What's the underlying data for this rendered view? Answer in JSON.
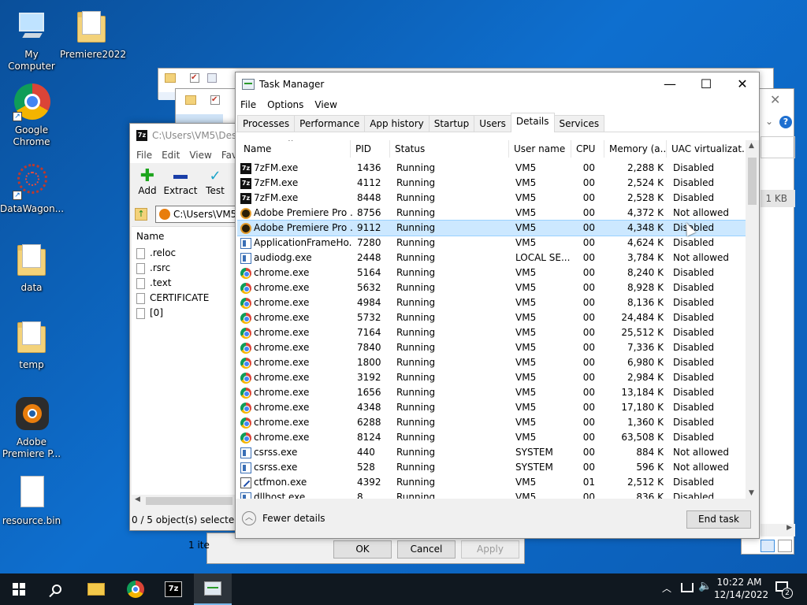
{
  "desktop": {
    "icons": [
      {
        "label": "My Computer",
        "icon": "monitor-icon"
      },
      {
        "label": "Premiere2022",
        "icon": "folder-icon"
      },
      {
        "label": "Google Chrome",
        "icon": "chrome-icon"
      },
      {
        "label": "DataWagon...",
        "icon": "datawagon-icon"
      },
      {
        "label": "data",
        "icon": "folder-icon"
      },
      {
        "label": "temp",
        "icon": "folder-icon"
      },
      {
        "label": "Adobe Premiere P...",
        "icon": "blender-icon"
      },
      {
        "label": "resource.bin",
        "icon": "file-icon"
      }
    ]
  },
  "zip_window": {
    "path": "C:\\Users\\VM5\\Desk",
    "menu": [
      "File",
      "Edit",
      "View",
      "Favo"
    ],
    "toolbar": {
      "add": "Add",
      "extract": "Extract",
      "test": "Test"
    },
    "address": "C:\\Users\\VM5\\",
    "list_header": "Name",
    "items": [
      ".reloc",
      ".rsrc",
      ".text",
      "CERTIFICATE",
      "[0]"
    ],
    "status": "0 / 5 object(s) selected"
  },
  "props_window": {
    "status_left": "1 ite",
    "ok": "OK",
    "cancel": "Cancel",
    "apply": "Apply"
  },
  "right_window": {
    "size_text": "1 KB"
  },
  "task_manager": {
    "title": "Task Manager",
    "menu": [
      "File",
      "Options",
      "View"
    ],
    "tabs": [
      "Processes",
      "Performance",
      "App history",
      "Startup",
      "Users",
      "Details",
      "Services"
    ],
    "active_tab": "Details",
    "columns": [
      "Name",
      "PID",
      "Status",
      "User name",
      "CPU",
      "Memory (a...",
      "UAC virtualizat..."
    ],
    "rows": [
      {
        "name": "7zFM.exe",
        "pid": "1436",
        "status": "Running",
        "user": "VM5",
        "cpu": "00",
        "mem": "2,288 K",
        "uac": "Disabled",
        "icon": "7z"
      },
      {
        "name": "7zFM.exe",
        "pid": "4112",
        "status": "Running",
        "user": "VM5",
        "cpu": "00",
        "mem": "2,524 K",
        "uac": "Disabled",
        "icon": "7z"
      },
      {
        "name": "7zFM.exe",
        "pid": "8448",
        "status": "Running",
        "user": "VM5",
        "cpu": "00",
        "mem": "2,528 K",
        "uac": "Disabled",
        "icon": "7z"
      },
      {
        "name": "Adobe Premiere Pro ...",
        "pid": "8756",
        "status": "Running",
        "user": "VM5",
        "cpu": "00",
        "mem": "4,372 K",
        "uac": "Not allowed",
        "icon": "pr"
      },
      {
        "name": "Adobe Premiere Pro ...",
        "pid": "9112",
        "status": "Running",
        "user": "VM5",
        "cpu": "00",
        "mem": "4,348 K",
        "uac": "Disabled",
        "icon": "pr"
      },
      {
        "name": "ApplicationFrameHo...",
        "pid": "7280",
        "status": "Running",
        "user": "VM5",
        "cpu": "00",
        "mem": "4,624 K",
        "uac": "Disabled",
        "icon": "app"
      },
      {
        "name": "audiodg.exe",
        "pid": "2448",
        "status": "Running",
        "user": "LOCAL SE...",
        "cpu": "00",
        "mem": "3,784 K",
        "uac": "Not allowed",
        "icon": "app"
      },
      {
        "name": "chrome.exe",
        "pid": "5164",
        "status": "Running",
        "user": "VM5",
        "cpu": "00",
        "mem": "8,240 K",
        "uac": "Disabled",
        "icon": "chrome"
      },
      {
        "name": "chrome.exe",
        "pid": "5632",
        "status": "Running",
        "user": "VM5",
        "cpu": "00",
        "mem": "8,928 K",
        "uac": "Disabled",
        "icon": "chrome"
      },
      {
        "name": "chrome.exe",
        "pid": "4984",
        "status": "Running",
        "user": "VM5",
        "cpu": "00",
        "mem": "8,136 K",
        "uac": "Disabled",
        "icon": "chrome"
      },
      {
        "name": "chrome.exe",
        "pid": "5732",
        "status": "Running",
        "user": "VM5",
        "cpu": "00",
        "mem": "24,484 K",
        "uac": "Disabled",
        "icon": "chrome"
      },
      {
        "name": "chrome.exe",
        "pid": "7164",
        "status": "Running",
        "user": "VM5",
        "cpu": "00",
        "mem": "25,512 K",
        "uac": "Disabled",
        "icon": "chrome"
      },
      {
        "name": "chrome.exe",
        "pid": "7840",
        "status": "Running",
        "user": "VM5",
        "cpu": "00",
        "mem": "7,336 K",
        "uac": "Disabled",
        "icon": "chrome"
      },
      {
        "name": "chrome.exe",
        "pid": "1800",
        "status": "Running",
        "user": "VM5",
        "cpu": "00",
        "mem": "6,980 K",
        "uac": "Disabled",
        "icon": "chrome"
      },
      {
        "name": "chrome.exe",
        "pid": "3192",
        "status": "Running",
        "user": "VM5",
        "cpu": "00",
        "mem": "2,984 K",
        "uac": "Disabled",
        "icon": "chrome"
      },
      {
        "name": "chrome.exe",
        "pid": "1656",
        "status": "Running",
        "user": "VM5",
        "cpu": "00",
        "mem": "13,184 K",
        "uac": "Disabled",
        "icon": "chrome"
      },
      {
        "name": "chrome.exe",
        "pid": "4348",
        "status": "Running",
        "user": "VM5",
        "cpu": "00",
        "mem": "17,180 K",
        "uac": "Disabled",
        "icon": "chrome"
      },
      {
        "name": "chrome.exe",
        "pid": "6288",
        "status": "Running",
        "user": "VM5",
        "cpu": "00",
        "mem": "1,360 K",
        "uac": "Disabled",
        "icon": "chrome"
      },
      {
        "name": "chrome.exe",
        "pid": "8124",
        "status": "Running",
        "user": "VM5",
        "cpu": "00",
        "mem": "63,508 K",
        "uac": "Disabled",
        "icon": "chrome"
      },
      {
        "name": "csrss.exe",
        "pid": "440",
        "status": "Running",
        "user": "SYSTEM",
        "cpu": "00",
        "mem": "884 K",
        "uac": "Not allowed",
        "icon": "app"
      },
      {
        "name": "csrss.exe",
        "pid": "528",
        "status": "Running",
        "user": "SYSTEM",
        "cpu": "00",
        "mem": "596 K",
        "uac": "Not allowed",
        "icon": "app"
      },
      {
        "name": "ctfmon.exe",
        "pid": "4392",
        "status": "Running",
        "user": "VM5",
        "cpu": "01",
        "mem": "2,512 K",
        "uac": "Disabled",
        "icon": "ctf"
      },
      {
        "name": "dllhost.exe",
        "pid": "8",
        "status": "Running",
        "user": "VM5",
        "cpu": "00",
        "mem": "836 K",
        "uac": "Disabled",
        "icon": "app"
      }
    ],
    "selected_index": 4,
    "fewer_details": "Fewer details",
    "end_task": "End task"
  },
  "taskbar": {
    "time": "10:22 AM",
    "date": "12/14/2022",
    "notification_count": "2"
  },
  "colors": {
    "selection": "#cce8ff",
    "desktop": "#0e6fcf",
    "taskbar": "#101820"
  }
}
